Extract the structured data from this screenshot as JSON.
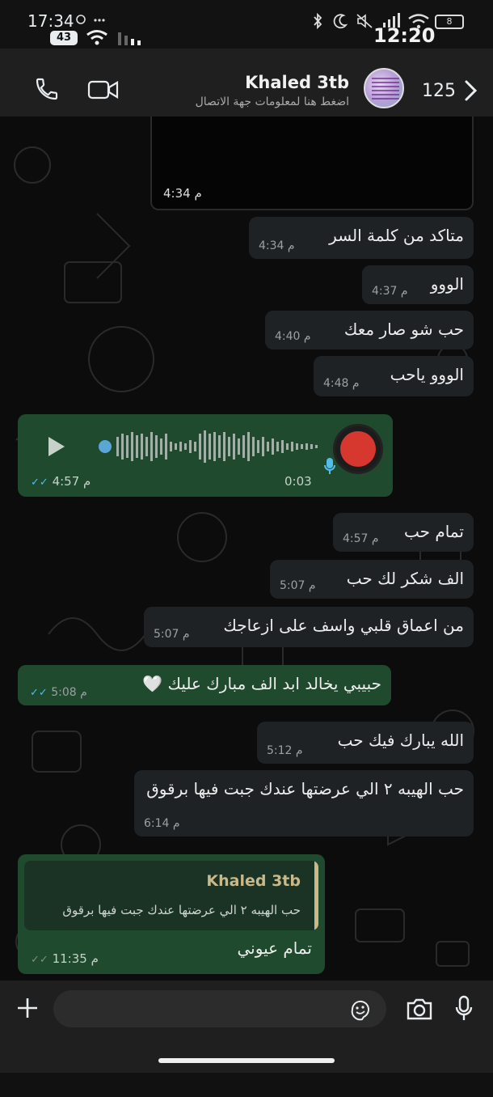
{
  "status_bar": {
    "time_left": "17:34",
    "badge": "43",
    "time_right": "12:20",
    "battery": "8"
  },
  "header": {
    "contact_name": "Khaled 3tb",
    "subtitle": "اضغط هنا لمعلومات جهة الاتصال",
    "unread_count": "125"
  },
  "chat": {
    "media_time": "4:34 م",
    "incoming": [
      {
        "text": "متاكد من كلمة السر",
        "time": "4:34 م"
      },
      {
        "text": "الووو",
        "time": "4:37 م"
      },
      {
        "text": "حب شو صار معك",
        "time": "4:40 م"
      },
      {
        "text": "الووو ياحب",
        "time": "4:48 م"
      }
    ],
    "voice": {
      "duration": "0:03",
      "time": "4:57 م"
    },
    "incoming2": [
      {
        "text": "تمام حب",
        "time": "4:57 م"
      },
      {
        "text": "الف شكر لك حب",
        "time": "5:07 م"
      },
      {
        "text": "من اعماق قلبي واسف على ازعاجك",
        "time": "5:07 م"
      }
    ],
    "outgoing1": {
      "text": "حبيبي يخالد ابد الف مبارك عليك 🤍",
      "time": "5:08 م"
    },
    "incoming3": [
      {
        "text": "الله يبارك فيك حب",
        "time": "5:12 م"
      },
      {
        "text": "حب الهيبه ٢ الي عرضتها عندك جبت فيها برقوق",
        "time": "6:14 م"
      }
    ],
    "reply": {
      "quote_name": "Khaled 3tb",
      "quote_text": "حب الهيبه ٢ الي عرضتها عندك جبت فيها برقوق",
      "text": "تمام عيوني",
      "time": "11:35 م"
    },
    "read_receipt": "✓✓"
  },
  "input": {
    "placeholder": ""
  },
  "colors": {
    "incoming_bubble": "#1f2225",
    "outgoing_bubble": "#1f4a2e",
    "tick_blue": "#53bdeb",
    "quote_accent": "#c9b98a"
  },
  "icons": [
    "phone-icon",
    "video-icon",
    "chevron-right-icon",
    "play-icon",
    "mic-icon",
    "plus-icon",
    "sticker-icon",
    "camera-icon"
  ]
}
